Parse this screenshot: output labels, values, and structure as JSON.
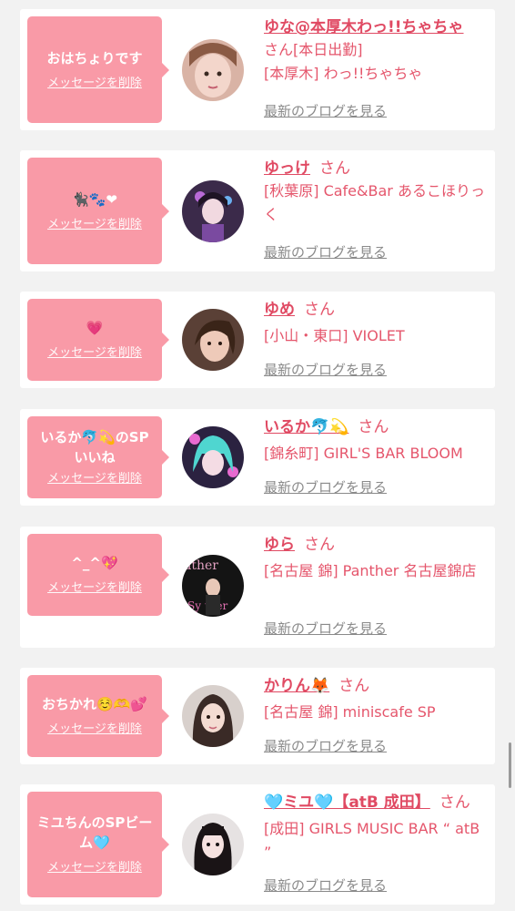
{
  "delete_label": "メッセージを削除",
  "blog_label": "最新のブログを見る",
  "san_label": "さん",
  "colors": {
    "page_bg": "#f2f2f2",
    "card_bg": "#ffffff",
    "bubble_bg": "#f99aa7",
    "accent_text": "#e5566c",
    "link_gray": "#8a8a8a"
  },
  "messages": [
    {
      "message": "おはちょりです",
      "cast_name": "ゆな@本厚木わっ!!ちゃちゃ",
      "status": "さん[本日出勤]",
      "shop": "[本厚木] わっ!!ちゃちゃ",
      "avatar_icon": "avatar-photo-icon"
    },
    {
      "message": "🐈‍⬛🐾❤",
      "cast_name": "ゆっけ",
      "status": "",
      "shop": "[秋葉原] Cafe&Bar あるこほりっく",
      "avatar_icon": "avatar-photo-icon"
    },
    {
      "message": "💗",
      "cast_name": "ゆめ",
      "status": "",
      "shop": "[小山・東口] VIOLET",
      "avatar_icon": "avatar-photo-icon"
    },
    {
      "message": "いるか🐬💫のSPいいね",
      "cast_name": "いるか🐬💫",
      "status": "",
      "shop": "[錦糸町] GIRL'S BAR BLOOM",
      "avatar_icon": "avatar-photo-icon"
    },
    {
      "message": "^_^💖",
      "cast_name": "ゆら",
      "status": "",
      "shop": "[名古屋 錦] Panther 名古屋錦店",
      "avatar_icon": "avatar-photo-icon"
    },
    {
      "message": "おちかれ☺️🫶💕",
      "cast_name": "かりん🦊",
      "status": "",
      "shop": "[名古屋 錦] miniscafe SP",
      "avatar_icon": "avatar-photo-icon"
    },
    {
      "message": "ミユちんのSPビーム🩵",
      "cast_name": "🩵ミユ🩵【atB 成田】",
      "status": "",
      "shop": "[成田] GIRLS MUSIC BAR “ atB ”",
      "avatar_icon": "avatar-photo-icon"
    }
  ]
}
